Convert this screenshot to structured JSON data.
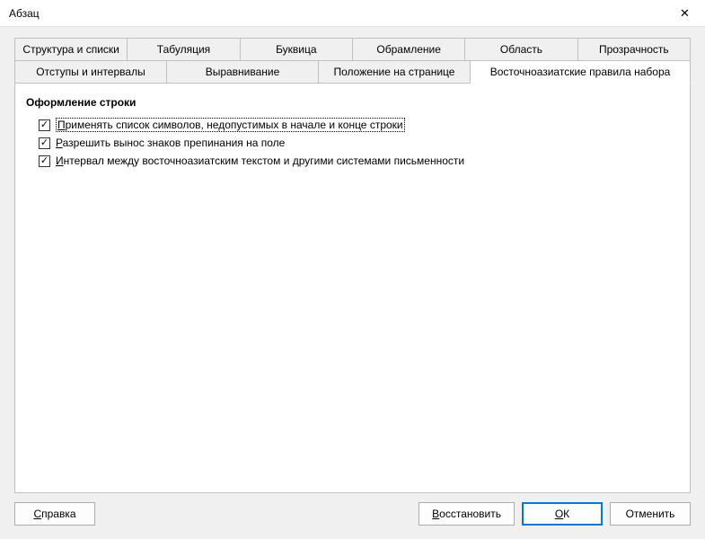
{
  "window": {
    "title": "Абзац"
  },
  "tabs": {
    "row1": [
      {
        "label": "Структура и списки"
      },
      {
        "label": "Табуляция"
      },
      {
        "label": "Буквица"
      },
      {
        "label": "Обрамление"
      },
      {
        "label": "Область"
      },
      {
        "label": "Прозрачность"
      }
    ],
    "row2": [
      {
        "label": "Отступы и интервалы"
      },
      {
        "label": "Выравнивание"
      },
      {
        "label": "Положение на странице"
      },
      {
        "label": "Восточноазиатские правила набора"
      }
    ]
  },
  "content": {
    "section_title": "Оформление строки",
    "options": [
      {
        "prefix": "П",
        "rest": "рименять список символов, недопустимых в начале и конце строки",
        "checked": true,
        "focused": true
      },
      {
        "prefix": "Р",
        "rest": "азрешить вынос знаков препинания на поле",
        "checked": true,
        "focused": false
      },
      {
        "prefix": "И",
        "rest": "нтервал между восточноазиатским текстом и другими системами письменности",
        "checked": true,
        "focused": false
      }
    ]
  },
  "buttons": {
    "help": {
      "prefix": "С",
      "rest": "правка"
    },
    "reset": {
      "prefix": "В",
      "rest": "осстановить"
    },
    "ok": {
      "prefix": "О",
      "rest": "К"
    },
    "cancel": {
      "prefix": "",
      "rest": "Отменить"
    }
  }
}
